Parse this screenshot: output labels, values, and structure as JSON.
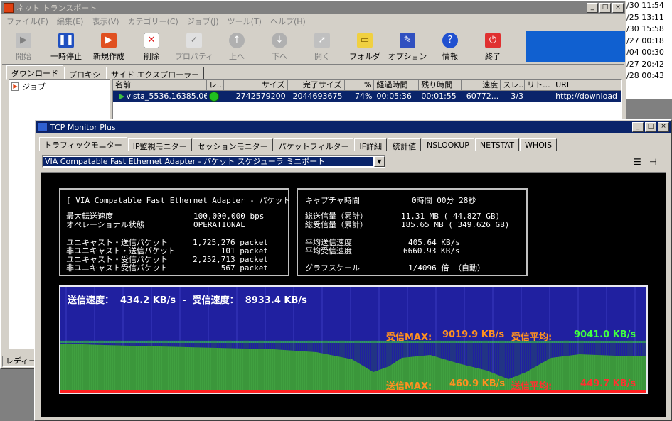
{
  "bg_timestamps": [
    "/30 11:54",
    "/25 13:11",
    "/30 15:58",
    "/27 00:18",
    "/04 00:30",
    "/27 20:42",
    "/28 00:43"
  ],
  "net": {
    "title": "ネット トランスポート",
    "menu": [
      "ファイル(F)",
      "編集(E)",
      "表示(V)",
      "カテゴリー(C)",
      "ジョブ(J)",
      "ツール(T)",
      "ヘルプ(H)"
    ],
    "toolbar": [
      "開始",
      "一時停止",
      "新規作成",
      "削除",
      "プロパティ",
      "上へ",
      "下へ",
      "開く",
      "フォルダ",
      "オプション",
      "情報",
      "終了"
    ],
    "tabs": [
      "ダウンロード",
      "プロキシ",
      "サイド エクスプローラー"
    ],
    "tree_item": "ジョブ",
    "columns": [
      "名前",
      "レ...",
      "サイズ",
      "完了サイズ",
      "%",
      "経過時間",
      "残り時間",
      "速度",
      "スレ...",
      "リト...",
      "URL"
    ],
    "job": {
      "name": "vista_5536.16385.06...",
      "size": "2742579200",
      "done": "2044693675",
      "pct": "74%",
      "elapsed": "00:05:36",
      "remaining": "00:01:55",
      "speed": "60772...",
      "threads": "3/3",
      "retry": "",
      "url": "http://download"
    },
    "status": "レディー"
  },
  "tcp": {
    "title": "TCP Monitor Plus",
    "tabs": [
      "トラフィックモニター",
      "IP監視モニター",
      "セッションモニター",
      "パケットフィルター",
      "IF詳細",
      "統計値",
      "NSLOOKUP",
      "NETSTAT",
      "WHOIS"
    ],
    "adapter": "VIA Compatable Fast Ethernet Adapter - パケット スケジューラ ミニポート",
    "left": {
      "header": "[ VIA Compatable Fast Ethernet Adapter - パケット ]",
      "rows": [
        {
          "k": "最大転送速度",
          "v": "100,000,000 bps"
        },
        {
          "k": "オペレーショナル状態",
          "v": "OPERATIONAL"
        },
        {
          "k": "ユニキャスト・送信パケット",
          "v": "1,725,276 packet"
        },
        {
          "k": "非ユニキャスト・送信パケット",
          "v": "101 packet"
        },
        {
          "k": "ユニキャスト・受信パケット",
          "v": "2,252,713 packet"
        },
        {
          "k": "非ユニキャスト受信パケット",
          "v": "567 packet"
        }
      ]
    },
    "right": {
      "capture_k": "キャプチャ時間",
      "capture_v": "0時間 00分 28秒",
      "sent_k": "総送信量（累計）",
      "sent_v": "11.31 MB ( 44.827 GB)",
      "recv_k": "総受信量（累計）",
      "recv_v": "185.65 MB ( 349.626 GB)",
      "avg_send_k": "平均送信速度",
      "avg_send_v": "405.64 KB/s",
      "avg_recv_k": "平均受信速度",
      "avg_recv_v": "6660.93 KB/s",
      "scale_k": "グラフスケール",
      "scale_v": "1/4096 倍 （自動）"
    },
    "graph": {
      "top": "送信速度：  434.2 KB/s  -  受信速度：  8933.4 KB/s",
      "recv_max_k": "受信MAX:",
      "recv_max_v": "9019.9 KB/s",
      "recv_avg_k": "受信平均:",
      "recv_avg_v": "9041.0 KB/s",
      "send_max_k": "送信MAX:",
      "send_max_v": "460.9 KB/s",
      "send_avg_k": "送信平均:",
      "send_avg_v": "449.7 KB/s",
      "colors": {
        "recv": "#40a040",
        "label_orange": "#ff9020",
        "label_green": "#40ff40",
        "label_red": "#ff3030"
      }
    }
  }
}
